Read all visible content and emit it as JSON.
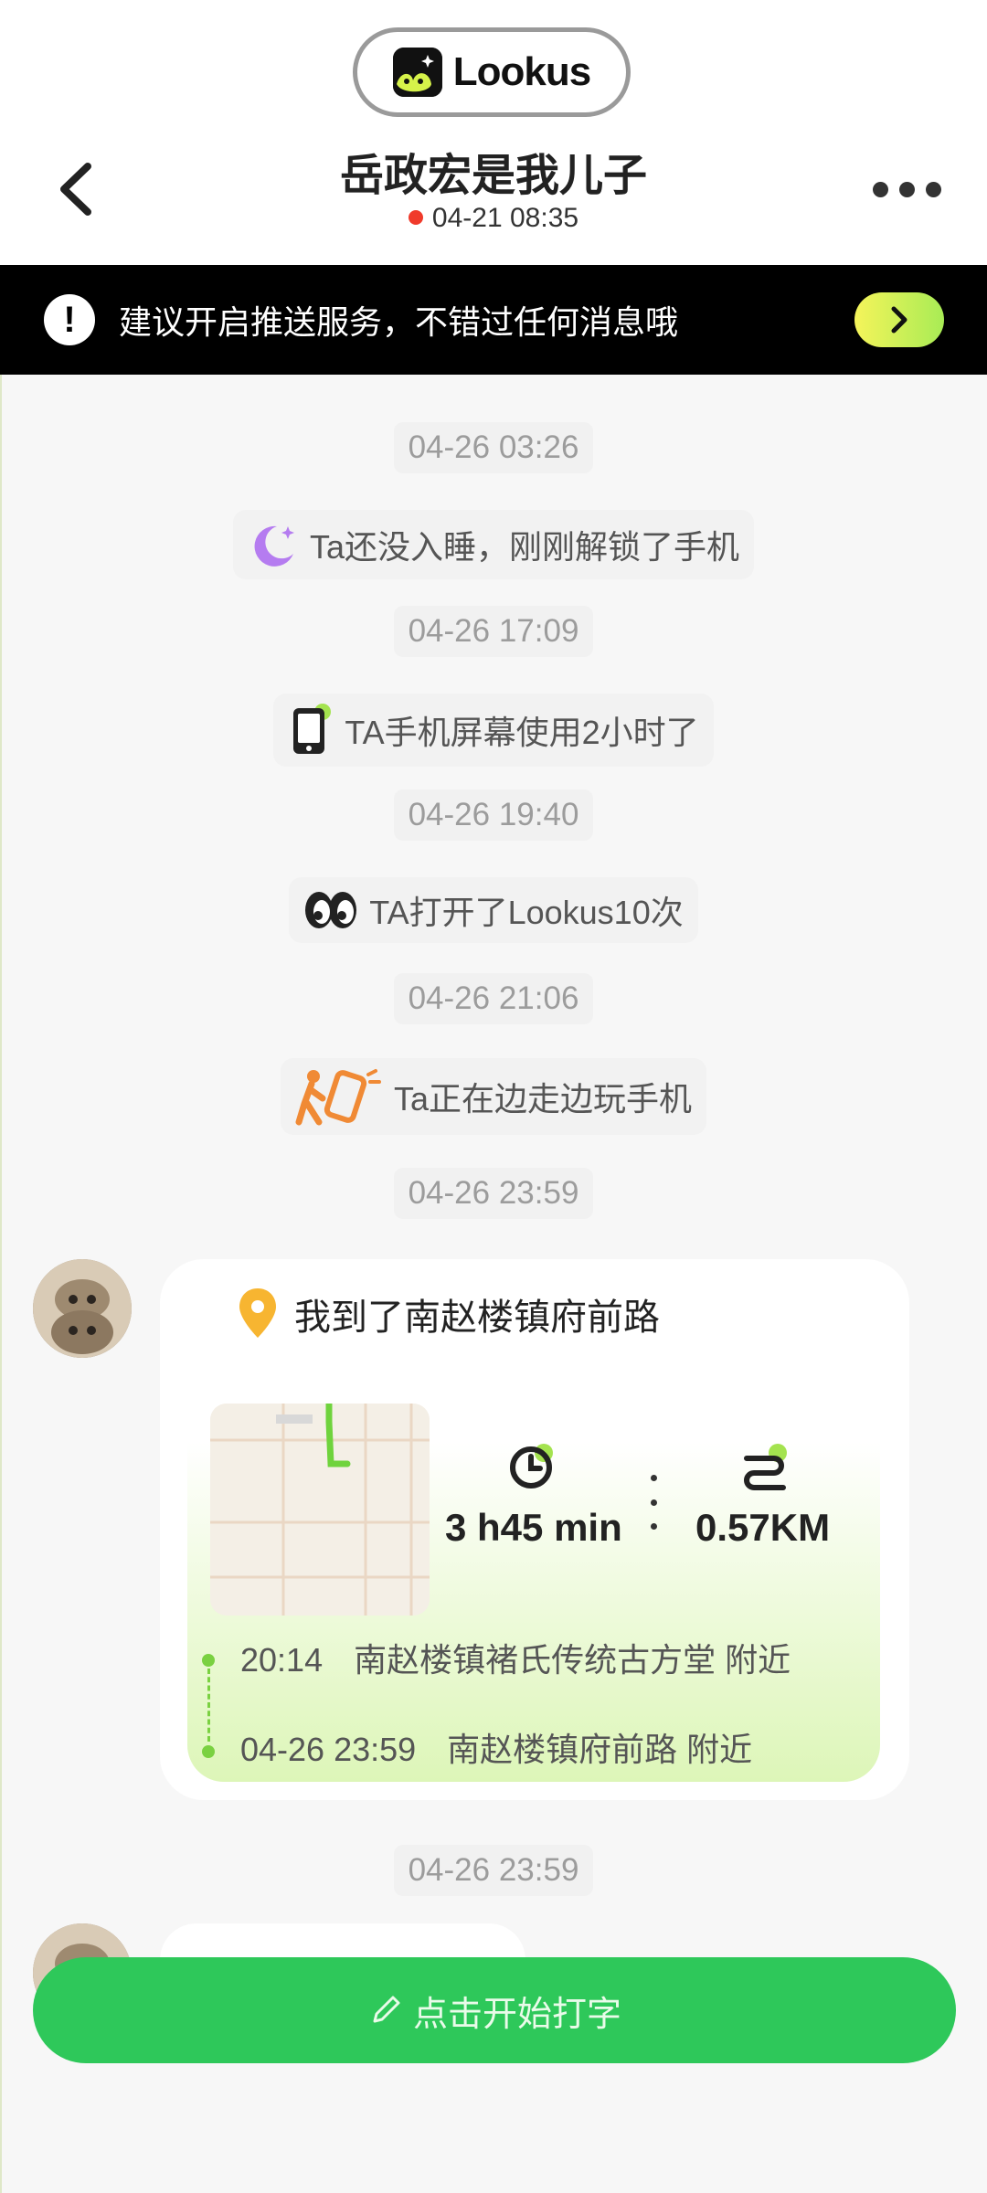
{
  "header": {
    "logo_text": "Lookus",
    "title": "岳政宏是我儿子",
    "status_time": "04-21 08:35",
    "status_color": "#f03a2b"
  },
  "banner": {
    "text": "建议开启推送服务，不错过任何消息哦",
    "icon": "exclamation-icon",
    "button_icon": "chevron-right-icon"
  },
  "timeline": [
    {
      "time": "04-26 03:26",
      "text": "Ta还没入睡，刚刚解锁了手机",
      "icon": "moon-icon"
    },
    {
      "time": "04-26 17:09",
      "text": "TA手机屏幕使用2小时了",
      "icon": "phone-icon"
    },
    {
      "time": "04-26 19:40",
      "text": "TA打开了Lookus10次",
      "icon": "eyes-icon"
    },
    {
      "time": "04-26 21:06",
      "text": "Ta正在边走边玩手机",
      "icon": "walking-phone-icon"
    }
  ],
  "trip": {
    "time": "04-26 23:59",
    "headline": "我到了南赵楼镇府前路",
    "duration": "3 h45 min",
    "distance": "0.57KM",
    "route": [
      {
        "time": "20:14",
        "place": "南赵楼镇褚氏传统古方堂 附近"
      },
      {
        "time": "04-26 23:59",
        "place": "南赵楼镇府前路 附近"
      }
    ]
  },
  "next_time": "04-26 23:59",
  "input": {
    "label": "点击开始打字"
  },
  "colors": {
    "accent_green": "#2ec85a",
    "route_green": "#7ad141",
    "banner_button": "#c8f05a"
  }
}
